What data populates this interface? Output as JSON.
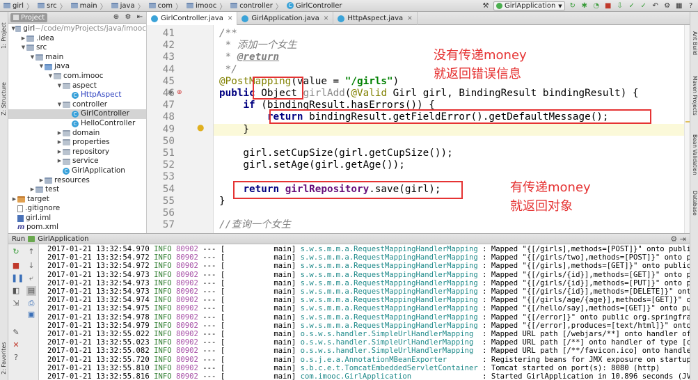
{
  "breadcrumbs": [
    {
      "label": "girl",
      "icon": "folder"
    },
    {
      "label": "src",
      "icon": "folder"
    },
    {
      "label": "main",
      "icon": "folder"
    },
    {
      "label": "java",
      "icon": "folder"
    },
    {
      "label": "com",
      "icon": "folder"
    },
    {
      "label": "imooc",
      "icon": "folder"
    },
    {
      "label": "controller",
      "icon": "folder"
    },
    {
      "label": "GirlController",
      "icon": "class"
    }
  ],
  "toolbar": {
    "run_config": "GirlApplication"
  },
  "left_tabs": [
    "1: Project",
    "Z: Structure",
    "2: Favorites"
  ],
  "right_tabs": [
    "Ant Build",
    "Maven Projects",
    "Bean Validation",
    "Database"
  ],
  "project": {
    "header": "Project",
    "tree": [
      {
        "depth": 0,
        "arrow": "▼",
        "icon": "folder",
        "label": "girl",
        "suffix": " ~/code/myProjects/java/imooc"
      },
      {
        "depth": 1,
        "arrow": "▶",
        "icon": "folder",
        "label": ".idea"
      },
      {
        "depth": 1,
        "arrow": "▼",
        "icon": "folder",
        "label": "src"
      },
      {
        "depth": 2,
        "arrow": "▼",
        "icon": "folder",
        "label": "main"
      },
      {
        "depth": 3,
        "arrow": "▼",
        "icon": "srcf",
        "label": "java"
      },
      {
        "depth": 4,
        "arrow": "▼",
        "icon": "pkg",
        "label": "com.imooc"
      },
      {
        "depth": 5,
        "arrow": "▼",
        "icon": "pkg",
        "label": "aspect"
      },
      {
        "depth": 6,
        "arrow": "",
        "icon": "class",
        "label": "HttpAspect",
        "blue": true
      },
      {
        "depth": 5,
        "arrow": "▼",
        "icon": "pkg",
        "label": "controller"
      },
      {
        "depth": 6,
        "arrow": "",
        "icon": "class",
        "label": "GirlController",
        "selected": true
      },
      {
        "depth": 6,
        "arrow": "",
        "icon": "class",
        "label": "HelloController"
      },
      {
        "depth": 5,
        "arrow": "▶",
        "icon": "pkg",
        "label": "domain"
      },
      {
        "depth": 5,
        "arrow": "▶",
        "icon": "pkg",
        "label": "properties"
      },
      {
        "depth": 5,
        "arrow": "▶",
        "icon": "pkg",
        "label": "repository"
      },
      {
        "depth": 5,
        "arrow": "▶",
        "icon": "pkg",
        "label": "service"
      },
      {
        "depth": 5,
        "arrow": "",
        "icon": "class",
        "label": "GirlApplication"
      },
      {
        "depth": 3,
        "arrow": "▶",
        "icon": "folder",
        "label": "resources"
      },
      {
        "depth": 2,
        "arrow": "▶",
        "icon": "folder",
        "label": "test"
      },
      {
        "depth": 0,
        "arrow": "▶",
        "icon": "target",
        "label": "target"
      },
      {
        "depth": 0,
        "arrow": "",
        "icon": "file",
        "label": ".gitignore"
      },
      {
        "depth": 0,
        "arrow": "",
        "icon": "iml",
        "label": "girl.iml"
      },
      {
        "depth": 0,
        "arrow": "",
        "icon": "m",
        "label": "pom.xml"
      }
    ]
  },
  "editor": {
    "tabs": [
      {
        "label": "GirlController.java",
        "active": true
      },
      {
        "label": "GirlApplication.java",
        "active": false
      },
      {
        "label": "HttpAspect.java",
        "active": false
      }
    ],
    "line_numbers": [
      "41",
      "42",
      "43",
      "44",
      "45",
      "46",
      "47",
      "48",
      "49",
      "50",
      "51",
      "52",
      "53",
      "54",
      "55",
      "56",
      "57"
    ],
    "lines": [
      [
        {
          "c": "cm",
          "t": "/**"
        }
      ],
      [
        {
          "c": "cm",
          "t": " * "
        },
        {
          "c": "cm cjk",
          "t": "添加一个女生"
        }
      ],
      [
        {
          "c": "cm",
          "t": " * "
        },
        {
          "c": "tag",
          "t": "@return"
        }
      ],
      [
        {
          "c": "cm",
          "t": " */"
        }
      ],
      [
        {
          "c": "an",
          "t": "@PostMapping"
        },
        {
          "c": "",
          "t": "(value = "
        },
        {
          "c": "str",
          "t": "\"/girls\""
        },
        {
          "c": "",
          "t": ")"
        }
      ],
      [
        {
          "c": "kw",
          "t": "public "
        },
        {
          "c": "",
          "t": "Object "
        },
        {
          "c": "muted",
          "t": "girlAdd"
        },
        {
          "c": "",
          "t": "("
        },
        {
          "c": "an",
          "t": "@Valid"
        },
        {
          "c": "",
          "t": " Girl girl, BindingResult bindingResult) {"
        }
      ],
      [
        {
          "c": "",
          "t": "    "
        },
        {
          "c": "kw",
          "t": "if "
        },
        {
          "c": "",
          "t": "(bindingResult.hasErrors()) {"
        }
      ],
      [
        {
          "c": "",
          "t": "        "
        },
        {
          "c": "kw",
          "t": "return "
        },
        {
          "c": "",
          "t": "bindingResult.getFieldError().getDefaultMessage();"
        }
      ],
      [
        {
          "c": "",
          "t": "    }"
        }
      ],
      [
        {
          "c": "",
          "t": ""
        }
      ],
      [
        {
          "c": "",
          "t": "    girl.setCupSize(girl.getCupSize());"
        }
      ],
      [
        {
          "c": "",
          "t": "    girl.setAge(girl.getAge());"
        }
      ],
      [
        {
          "c": "",
          "t": ""
        }
      ],
      [
        {
          "c": "",
          "t": "    "
        },
        {
          "c": "kw",
          "t": "return "
        },
        {
          "c": "fld",
          "t": "girlRepository"
        },
        {
          "c": "",
          "t": ".save(girl);"
        }
      ],
      [
        {
          "c": "",
          "t": "}"
        }
      ],
      [
        {
          "c": "",
          "t": ""
        }
      ],
      [
        {
          "c": "cm",
          "t": "//"
        },
        {
          "c": "cm cjk",
          "t": "查询一个女生"
        }
      ]
    ],
    "annotation_top": "没有传递money\n就返回错误信息",
    "annotation_bottom": "有传递money\n就返回对象"
  },
  "run": {
    "title": "Run",
    "config": "GirlApplication",
    "logs": [
      {
        "ts": "2017-01-21 13:32:54.970",
        "lvl": "INFO",
        "pid": "80902",
        "th": "---",
        "thread": "[           main]",
        "cls": "s.w.s.m.m.a.RequestMappingHandlerMapping",
        "msg": ": Mapped \"{[/girls],methods=[POST]}\" onto publi"
      },
      {
        "ts": "2017-01-21 13:32:54.972",
        "lvl": "INFO",
        "pid": "80902",
        "th": "---",
        "thread": "[           main]",
        "cls": "s.w.s.m.m.a.RequestMappingHandlerMapping",
        "msg": ": Mapped \"{[/girls/two],methods=[POST]}\" onto p"
      },
      {
        "ts": "2017-01-21 13:32:54.972",
        "lvl": "INFO",
        "pid": "80902",
        "th": "---",
        "thread": "[           main]",
        "cls": "s.w.s.m.m.a.RequestMappingHandlerMapping",
        "msg": ": Mapped \"{[/girls],methods=[GET]}\" onto public"
      },
      {
        "ts": "2017-01-21 13:32:54.973",
        "lvl": "INFO",
        "pid": "80902",
        "th": "---",
        "thread": "[           main]",
        "cls": "s.w.s.m.m.a.RequestMappingHandlerMapping",
        "msg": ": Mapped \"{[/girls/{id}],methods=[GET]}\" onto p"
      },
      {
        "ts": "2017-01-21 13:32:54.973",
        "lvl": "INFO",
        "pid": "80902",
        "th": "---",
        "thread": "[           main]",
        "cls": "s.w.s.m.m.a.RequestMappingHandlerMapping",
        "msg": ": Mapped \"{[/girls/{id}],methods=[PUT]}\" onto p"
      },
      {
        "ts": "2017-01-21 13:32:54.973",
        "lvl": "INFO",
        "pid": "80902",
        "th": "---",
        "thread": "[           main]",
        "cls": "s.w.s.m.m.a.RequestMappingHandlerMapping",
        "msg": ": Mapped \"{[/girls/{id}],methods=[DELETE]}\" ont"
      },
      {
        "ts": "2017-01-21 13:32:54.974",
        "lvl": "INFO",
        "pid": "80902",
        "th": "---",
        "thread": "[           main]",
        "cls": "s.w.s.m.m.a.RequestMappingHandlerMapping",
        "msg": ": Mapped \"{[/girls/age/{age}],methods=[GET]}\" o"
      },
      {
        "ts": "2017-01-21 13:32:54.975",
        "lvl": "INFO",
        "pid": "80902",
        "th": "---",
        "thread": "[           main]",
        "cls": "s.w.s.m.m.a.RequestMappingHandlerMapping",
        "msg": ": Mapped \"{[/hello/say],methods=[GET]}\" onto pu"
      },
      {
        "ts": "2017-01-21 13:32:54.978",
        "lvl": "INFO",
        "pid": "80902",
        "th": "---",
        "thread": "[           main]",
        "cls": "s.w.s.m.m.a.RequestMappingHandlerMapping",
        "msg": ": Mapped \"{[/error]}\" onto public org.springfra"
      },
      {
        "ts": "2017-01-21 13:32:54.979",
        "lvl": "INFO",
        "pid": "80902",
        "th": "---",
        "thread": "[           main]",
        "cls": "s.w.s.m.m.a.RequestMappingHandlerMapping",
        "msg": ": Mapped \"{[/error],produces=[text/html]}\" onto"
      },
      {
        "ts": "2017-01-21 13:32:55.022",
        "lvl": "INFO",
        "pid": "80902",
        "th": "---",
        "thread": "[           main]",
        "cls": "o.s.w.s.handler.SimpleUrlHandlerMapping",
        "msg": " : Mapped URL path [/webjars/**] onto handler of"
      },
      {
        "ts": "2017-01-21 13:32:55.023",
        "lvl": "INFO",
        "pid": "80902",
        "th": "---",
        "thread": "[           main]",
        "cls": "o.s.w.s.handler.SimpleUrlHandlerMapping",
        "msg": " : Mapped URL path [/**] onto handler of type [c"
      },
      {
        "ts": "2017-01-21 13:32:55.082",
        "lvl": "INFO",
        "pid": "80902",
        "th": "---",
        "thread": "[           main]",
        "cls": "o.s.w.s.handler.SimpleUrlHandlerMapping",
        "msg": " : Mapped URL path [/**/favicon.ico] onto handle"
      },
      {
        "ts": "2017-01-21 13:32:55.720",
        "lvl": "INFO",
        "pid": "80902",
        "th": "---",
        "thread": "[           main]",
        "cls": "o.s.j.e.a.AnnotationMBeanExporter",
        "msg": "       : Registering beans for JMX exposure on startup"
      },
      {
        "ts": "2017-01-21 13:32:55.810",
        "lvl": "INFO",
        "pid": "80902",
        "th": "---",
        "thread": "[           main]",
        "cls": "s.b.c.e.t.TomcatEmbeddedServletContainer",
        "msg": ": Tomcat started on port(s): 8080 (http)"
      },
      {
        "ts": "2017-01-21 13:32:55.816",
        "lvl": "INFO",
        "pid": "80902",
        "th": "---",
        "thread": "[           main]",
        "cls": "com.imooc.GirlApplication",
        "msg": "               : Started GirlApplication in 10.896 seconds (JV"
      }
    ]
  }
}
